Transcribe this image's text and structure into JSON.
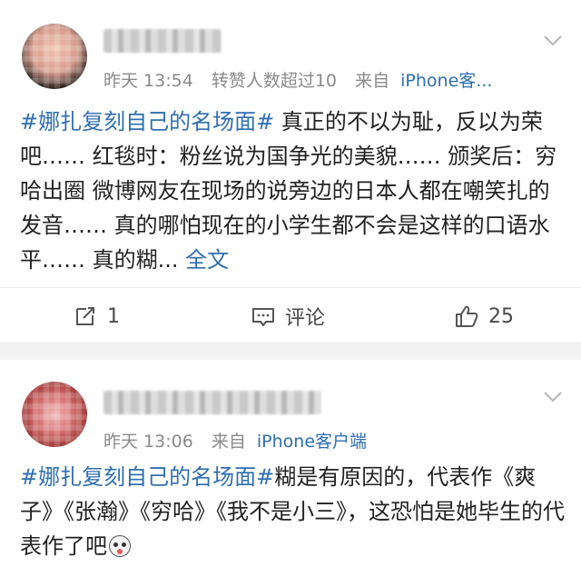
{
  "posts": [
    {
      "meta": {
        "time": "昨天 13:54",
        "extra": "转赞人数超过10",
        "from": "来自",
        "source": "iPhone客..."
      },
      "text": {
        "hashtag": "#娜扎复刻自己的名场面#",
        "body": " 真正的不以为耻，反以为荣吧…… 红毯时：粉丝说为国争光的美貌…… 颁奖后：穷哈出圈 微博网友在现场的说旁边的日本人都在嘲笑扎的发音…… 真的哪怕现在的小学生都不会是这样的口语水平…… 真的糊...",
        "more": "全文"
      },
      "actions": {
        "repost_count": "1",
        "comment_label": "评论",
        "like_count": "25"
      }
    },
    {
      "meta": {
        "time": "昨天 13:06",
        "from": "来自",
        "source": "iPhone客户端"
      },
      "text": {
        "hashtag": "#娜扎复刻自己的名场面#",
        "body": "糊是有原因的，代表作《爽子》《张瀚》《穷哈》《我不是小三》，这恐怕是她毕生的代表作了吧"
      }
    }
  ],
  "colors": {
    "link": "#2f6fb1",
    "meta": "#8a8a8a",
    "background": "#f2f2f2"
  },
  "icons": [
    "chevron-down-icon",
    "repost-icon",
    "comment-icon",
    "like-icon",
    "emoji-icon"
  ]
}
